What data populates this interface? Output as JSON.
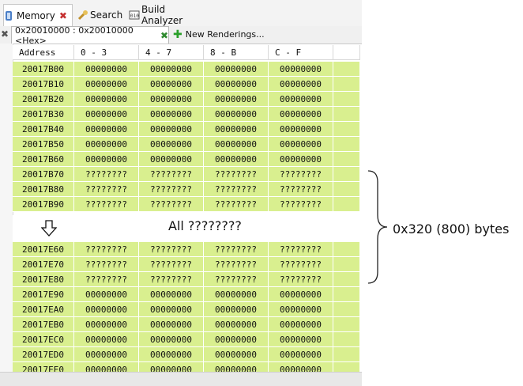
{
  "view_tabs": [
    {
      "label": "Memory",
      "active": true,
      "closable": true,
      "icon": "memory-icon"
    },
    {
      "label": "Search",
      "active": false,
      "icon": "search-icon"
    },
    {
      "label": "Build Analyzer",
      "active": false,
      "icon": "build-analyzer-icon"
    }
  ],
  "renderings": {
    "active_tab": "0x20010000 : 0x20010000 <Hex>",
    "new_renderings": "New Renderings..."
  },
  "table": {
    "headers": [
      "Address",
      "0 - 3",
      "4 - 7",
      "8 - B",
      "C - F"
    ],
    "top_rows": [
      [
        "20017B00",
        "00000000",
        "00000000",
        "00000000",
        "00000000"
      ],
      [
        "20017B10",
        "00000000",
        "00000000",
        "00000000",
        "00000000"
      ],
      [
        "20017B20",
        "00000000",
        "00000000",
        "00000000",
        "00000000"
      ],
      [
        "20017B30",
        "00000000",
        "00000000",
        "00000000",
        "00000000"
      ],
      [
        "20017B40",
        "00000000",
        "00000000",
        "00000000",
        "00000000"
      ],
      [
        "20017B50",
        "00000000",
        "00000000",
        "00000000",
        "00000000"
      ],
      [
        "20017B60",
        "00000000",
        "00000000",
        "00000000",
        "00000000"
      ],
      [
        "20017B70",
        "????????",
        "????????",
        "????????",
        "????????"
      ],
      [
        "20017B80",
        "????????",
        "????????",
        "????????",
        "????????"
      ],
      [
        "20017B90",
        "????????",
        "????????",
        "????????",
        "????????"
      ]
    ],
    "bottom_rows": [
      [
        "20017E60",
        "????????",
        "????????",
        "????????",
        "????????"
      ],
      [
        "20017E70",
        "????????",
        "????????",
        "????????",
        "????????"
      ],
      [
        "20017E80",
        "????????",
        "????????",
        "????????",
        "????????"
      ],
      [
        "20017E90",
        "00000000",
        "00000000",
        "00000000",
        "00000000"
      ],
      [
        "20017EA0",
        "00000000",
        "00000000",
        "00000000",
        "00000000"
      ],
      [
        "20017EB0",
        "00000000",
        "00000000",
        "00000000",
        "00000000"
      ],
      [
        "20017EC0",
        "00000000",
        "00000000",
        "00000000",
        "00000000"
      ],
      [
        "20017ED0",
        "00000000",
        "00000000",
        "00000000",
        "00000000"
      ],
      [
        "20017EE0",
        "00000000",
        "00000000",
        "00000000",
        "00000000"
      ]
    ]
  },
  "annotations": {
    "gap_label": "All ????????",
    "range_label": "0x320 (800) bytes"
  },
  "colors": {
    "row_bg": "#d9ef8f",
    "close_red": "#c53030",
    "tab_bg": "#f3f3f3"
  }
}
